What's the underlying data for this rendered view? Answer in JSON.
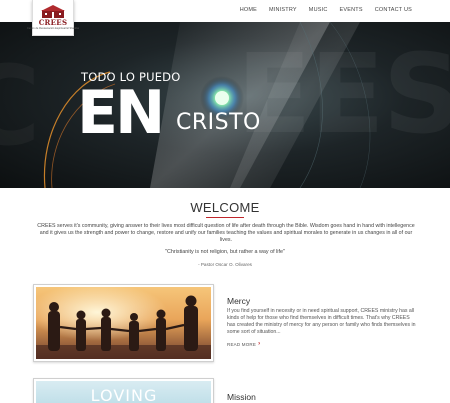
{
  "logo": {
    "text": "CREES",
    "subtitle": "Centro de Restauración Espiritual El Shaddai"
  },
  "nav": {
    "items": [
      "HOME",
      "MINISTRY",
      "MUSIC",
      "EVENTS",
      "CONTACT US"
    ]
  },
  "hero": {
    "line1": "TODO LO PUEDO",
    "line2": "EN",
    "line3": "CRISTO"
  },
  "welcome": {
    "title": "WELCOME",
    "body": "CREES serves it's community, giving answer to their lives most difficult question of life after death through the Bible. Wisdom goes hand in hand with intellegence and it gives us the strength and power to change, restore and unify our families teaching the values and spiritual morales to generate in us changes in all of our lives.",
    "quote": "\"Christianity is not religion, but rather a way of life\"",
    "quote_author": "- Pastor Oscar O. Olivares"
  },
  "cards": [
    {
      "title": "Mercy",
      "text": "If you find yourself in necesity or in need spiritual support, CREES ministry has all kinds of help for those who find themselves in difficult times. That's why CREES has created the ministry of mercy for any person or family who finds themselves in some sort of situation...",
      "link": "READ MORE",
      "image_text": ""
    },
    {
      "title": "Mission",
      "text": "",
      "link": "",
      "image_text": "LOVING"
    }
  ],
  "colors": {
    "accent": "#c0262b",
    "hero_bg": "#1d2427"
  }
}
